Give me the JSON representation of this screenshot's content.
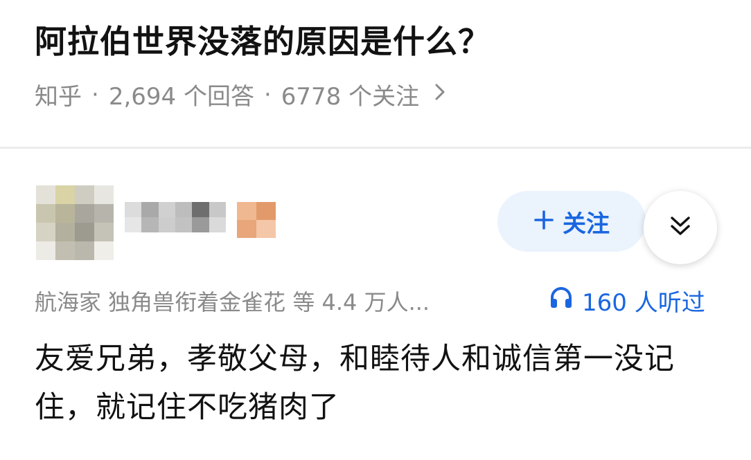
{
  "question": {
    "title": "阿拉伯世界没落的原因是什么？",
    "source": "知乎",
    "separator": "·",
    "answers": "2,694 个回答",
    "followers": "6778 个关注",
    "chevron_icon": "chevron-right-icon"
  },
  "answer": {
    "follow_label": "关注",
    "follow_icon": "plus-icon",
    "expand_icon": "double-chevron-down-icon",
    "upvoters": "航海家 独角兽衔着金雀花 等 4.4 万人...",
    "listened_icon": "headphones-icon",
    "listened": "160 人听过",
    "text": "友爱兄弟，孝敬父母，和睦待人和诚信第一没记住，就记住不吃猪肉了"
  },
  "colors": {
    "accent": "#1a66e0",
    "follow_bg": "#ebf3fd",
    "muted_text": "#8a8a8a",
    "primary_text": "#121212",
    "divider": "#ececec"
  }
}
